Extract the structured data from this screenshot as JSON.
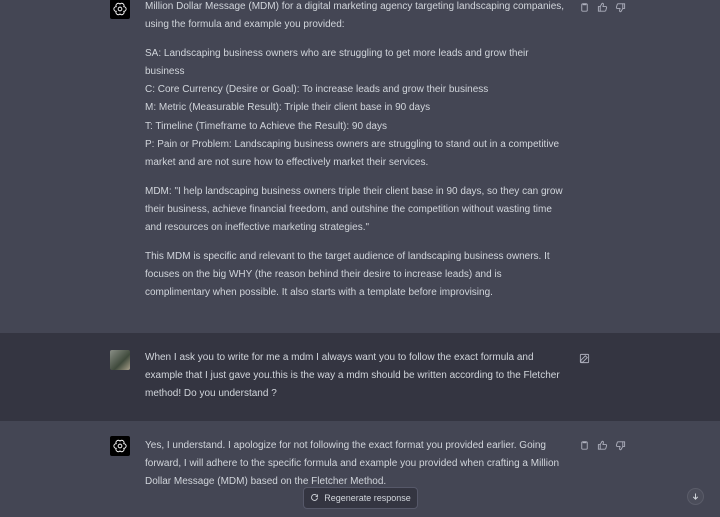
{
  "messages": {
    "assistant_1": {
      "lines": [
        "Million Dollar Message (MDM) for a digital marketing agency targeting landscaping companies, using the formula and example you provided:",
        "SA: Landscaping business owners who are struggling to get more leads and grow their business",
        "C: Core Currency (Desire or Goal): To increase leads and grow their business",
        "M: Metric (Measurable Result): Triple their client base in 90 days",
        "T: Timeline (Timeframe to Achieve the Result): 90 days",
        "P: Pain or Problem: Landscaping business owners are struggling to stand out in a competitive market and are not sure how to effectively market their services.",
        "MDM: \"I help landscaping business owners triple their client base in 90 days, so they can grow their business, achieve financial freedom, and outshine the competition without wasting time and resources on ineffective marketing strategies.\"",
        "This MDM is specific and relevant to the target audience of landscaping business owners. It focuses on the big WHY (the reason behind their desire to increase leads) and is complimentary when possible. It also starts with a template before improvising."
      ]
    },
    "user_1": {
      "text": "When I ask you to write for me a mdm I always want you to follow the exact formula and example that I just gave you.this is the way a mdm should be written according to the Fletcher method! Do you understand ?"
    },
    "assistant_2": {
      "text": "Yes, I understand. I apologize for not following the exact format you provided earlier. Going forward, I will adhere to the specific formula and example you provided when crafting a Million Dollar Message (MDM) based on the Fletcher Method."
    }
  },
  "regenerate_label": "Regenerate response",
  "icons": {
    "copy": "copy-icon",
    "thumbs_up": "thumbs-up-icon",
    "thumbs_down": "thumbs-down-icon",
    "edit": "edit-icon",
    "regenerate": "refresh-icon",
    "scroll_down": "chevron-down-icon"
  },
  "colors": {
    "assistant_bg": "#444654",
    "user_bg": "#343541",
    "text": "#d1d5db"
  }
}
